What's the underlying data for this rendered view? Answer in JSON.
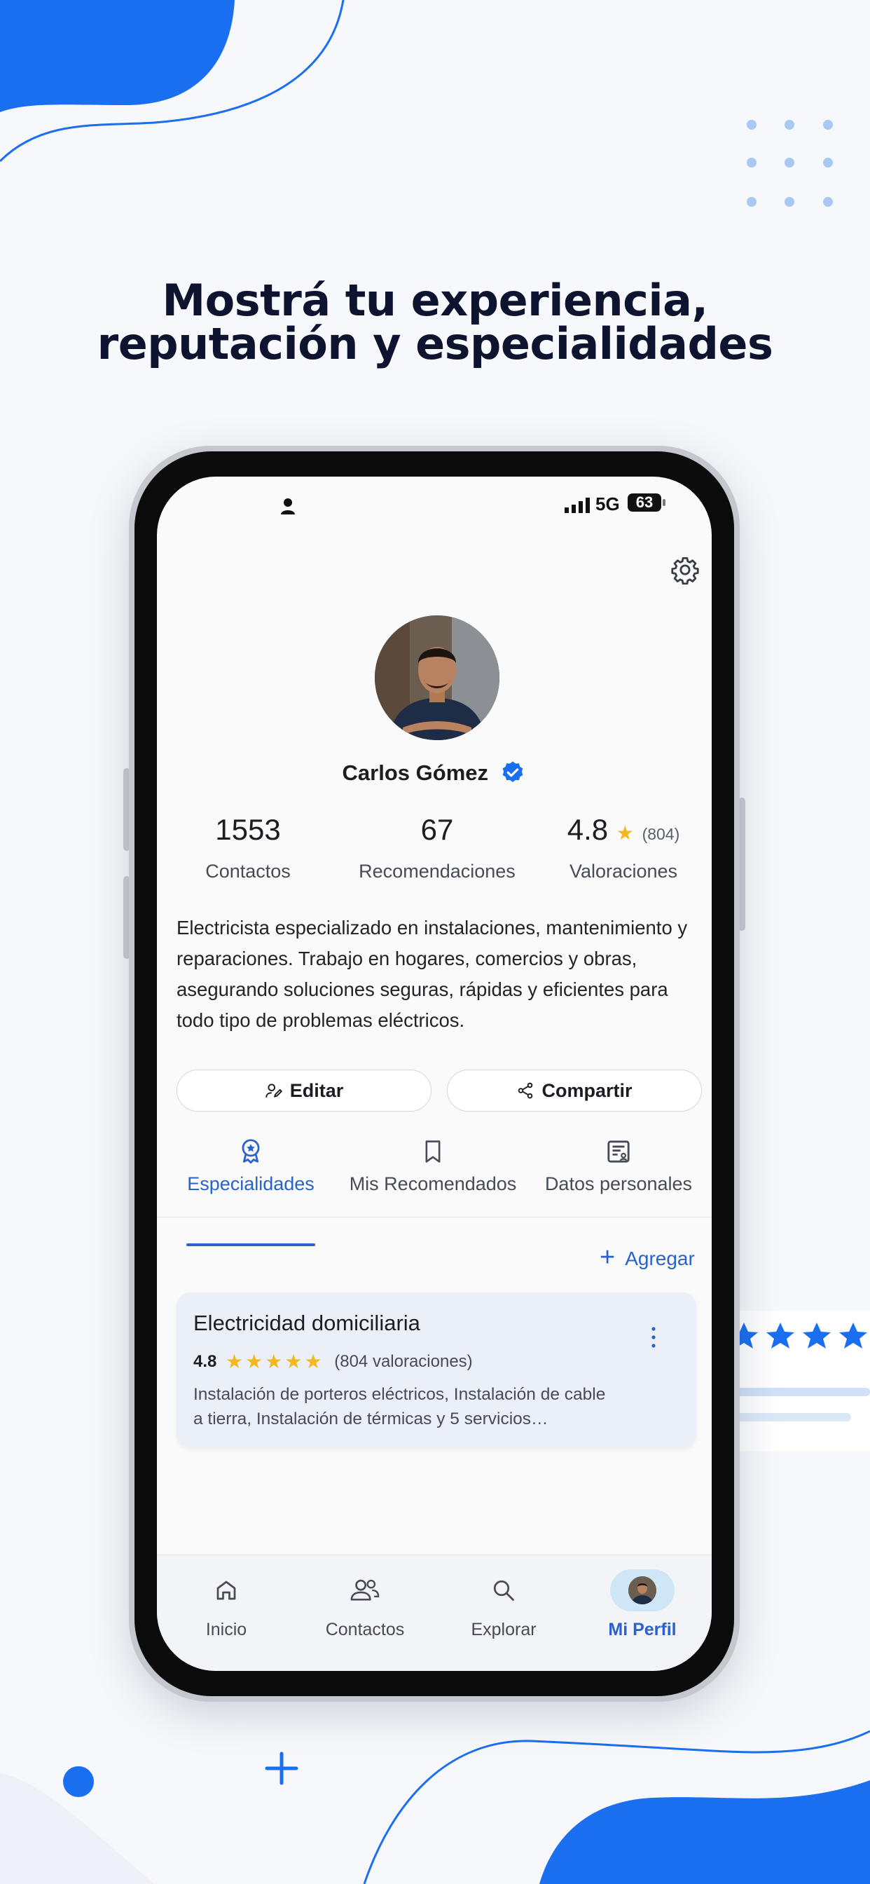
{
  "headline": [
    "Mostrá tu experiencia,",
    "reputación y especialidades"
  ],
  "status_bar": {
    "network": "5G",
    "battery": "63"
  },
  "profile": {
    "name": "Carlos Gómez",
    "stats": [
      {
        "value": "1553",
        "label": "Contactos"
      },
      {
        "value": "67",
        "label": "Recomendaciones"
      },
      {
        "value": "4.8",
        "count": "(804)",
        "label": "Valoraciones"
      }
    ],
    "bio": "Electricista especializado en instalaciones, mantenimiento y reparaciones. Trabajo en hogares, comercios y obras, asegurando soluciones seguras, rápidas y eficientes para todo tipo de problemas eléctricos."
  },
  "actions": {
    "edit": "Editar",
    "share": "Compartir"
  },
  "tabs": [
    {
      "label": "Especialidades",
      "icon": "badge-icon",
      "active": true
    },
    {
      "label": "Mis Recomendados",
      "icon": "bookmark-icon",
      "active": false
    },
    {
      "label": "Datos personales",
      "icon": "profile-card-icon",
      "active": false
    }
  ],
  "add_label": "Agregar",
  "specialty": {
    "title": "Electricidad domiciliaria",
    "rating": "4.8",
    "stars": 5,
    "count": "(804 valoraciones)",
    "description": "Instalación de porteros eléctricos, Instalación de cable a tierra, Instalación de térmicas y 5 servicios…"
  },
  "nav": [
    {
      "label": "Inicio",
      "icon": "home-icon"
    },
    {
      "label": "Contactos",
      "icon": "contacts-icon"
    },
    {
      "label": "Explorar",
      "icon": "search-icon"
    },
    {
      "label": "Mi Perfil",
      "icon": "avatar-icon",
      "active": true
    }
  ],
  "colors": {
    "accent": "#2a62c9",
    "brand_blue": "#1a6ff0",
    "star": "#f3b81f",
    "headline": "#0e1430"
  }
}
